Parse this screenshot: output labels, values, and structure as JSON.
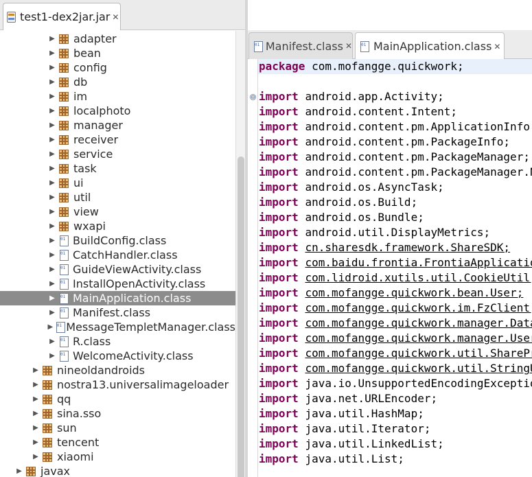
{
  "left_panel": {
    "tab": {
      "label": "test1-dex2jar.jar",
      "close": "✕"
    },
    "tree": [
      {
        "label": "adapter",
        "kind": "package",
        "indent": 2
      },
      {
        "label": "bean",
        "kind": "package",
        "indent": 2
      },
      {
        "label": "config",
        "kind": "package",
        "indent": 2
      },
      {
        "label": "db",
        "kind": "package",
        "indent": 2
      },
      {
        "label": "im",
        "kind": "package",
        "indent": 2
      },
      {
        "label": "localphoto",
        "kind": "package",
        "indent": 2
      },
      {
        "label": "manager",
        "kind": "package",
        "indent": 2
      },
      {
        "label": "receiver",
        "kind": "package",
        "indent": 2
      },
      {
        "label": "service",
        "kind": "package",
        "indent": 2
      },
      {
        "label": "task",
        "kind": "package",
        "indent": 2
      },
      {
        "label": "ui",
        "kind": "package",
        "indent": 2
      },
      {
        "label": "util",
        "kind": "package",
        "indent": 2
      },
      {
        "label": "view",
        "kind": "package",
        "indent": 2
      },
      {
        "label": "wxapi",
        "kind": "package",
        "indent": 2
      },
      {
        "label": "BuildConfig.class",
        "kind": "class",
        "indent": 2
      },
      {
        "label": "CatchHandler.class",
        "kind": "class",
        "indent": 2
      },
      {
        "label": "GuideViewActivity.class",
        "kind": "class",
        "indent": 2
      },
      {
        "label": "InstallOpenActivity.class",
        "kind": "class",
        "indent": 2
      },
      {
        "label": "MainApplication.class",
        "kind": "class",
        "indent": 2,
        "selected": true
      },
      {
        "label": "Manifest.class",
        "kind": "class",
        "indent": 2
      },
      {
        "label": "MessageTempletManager.class",
        "kind": "class",
        "indent": 2
      },
      {
        "label": "R.class",
        "kind": "class",
        "indent": 2
      },
      {
        "label": "WelcomeActivity.class",
        "kind": "class",
        "indent": 2
      },
      {
        "label": "nineoldandroids",
        "kind": "package",
        "indent": 1
      },
      {
        "label": "nostra13.universalimageloader",
        "kind": "package",
        "indent": 1
      },
      {
        "label": "qq",
        "kind": "package",
        "indent": 1
      },
      {
        "label": "sina.sso",
        "kind": "package",
        "indent": 1
      },
      {
        "label": "sun",
        "kind": "package",
        "indent": 1
      },
      {
        "label": "tencent",
        "kind": "package",
        "indent": 1
      },
      {
        "label": "xiaomi",
        "kind": "package",
        "indent": 1
      },
      {
        "label": "javax",
        "kind": "package",
        "indent": 0
      }
    ]
  },
  "editor": {
    "tabs": [
      {
        "label": "Manifest.class",
        "active": false,
        "close": "✕"
      },
      {
        "label": "MainApplication.class",
        "active": true,
        "close": "✕"
      }
    ],
    "fold_marker": "⊖",
    "lines": [
      {
        "kw": "package",
        "rest": " com.mofangge.quickwork;",
        "hl": true
      },
      {
        "kw": "",
        "rest": ""
      },
      {
        "kw": "import",
        "rest": " android.app.Activity;"
      },
      {
        "kw": "import",
        "rest": " android.content.Intent;"
      },
      {
        "kw": "import",
        "rest": " android.content.pm.ApplicationInfo;"
      },
      {
        "kw": "import",
        "rest": " android.content.pm.PackageInfo;"
      },
      {
        "kw": "import",
        "rest": " android.content.pm.PackageManager;"
      },
      {
        "kw": "import",
        "rest": " android.content.pm.PackageManager.NameNotFoundException;"
      },
      {
        "kw": "import",
        "rest": " android.os.AsyncTask;"
      },
      {
        "kw": "import",
        "rest": " android.os.Build;"
      },
      {
        "kw": "import",
        "rest": " android.os.Bundle;"
      },
      {
        "kw": "import",
        "rest": " android.util.DisplayMetrics;"
      },
      {
        "kw": "import",
        "rest": " cn.sharesdk.framework.ShareSDK;",
        "link": true
      },
      {
        "kw": "import",
        "rest": " com.baidu.frontia.FrontiaApplication;",
        "link": true
      },
      {
        "kw": "import",
        "rest": " com.lidroid.xutils.util.CookieUtil;",
        "link": true
      },
      {
        "kw": "import",
        "rest": " com.mofangge.quickwork.bean.User;",
        "link": true
      },
      {
        "kw": "import",
        "rest": " com.mofangge.quickwork.im.FzClient;",
        "link": true
      },
      {
        "kw": "import",
        "rest": " com.mofangge.quickwork.manager.DataManager;",
        "link": true
      },
      {
        "kw": "import",
        "rest": " com.mofangge.quickwork.manager.UserManager;",
        "link": true
      },
      {
        "kw": "import",
        "rest": " com.mofangge.quickwork.util.SharePreferenceUtil;",
        "link": true
      },
      {
        "kw": "import",
        "rest": " com.mofangge.quickwork.util.StringUtil;",
        "link": true
      },
      {
        "kw": "import",
        "rest": " java.io.UnsupportedEncodingException;"
      },
      {
        "kw": "import",
        "rest": " java.net.URLEncoder;"
      },
      {
        "kw": "import",
        "rest": " java.util.HashMap;"
      },
      {
        "kw": "import",
        "rest": " java.util.Iterator;"
      },
      {
        "kw": "import",
        "rest": " java.util.LinkedList;"
      },
      {
        "kw": "import",
        "rest": " java.util.List;"
      }
    ]
  }
}
